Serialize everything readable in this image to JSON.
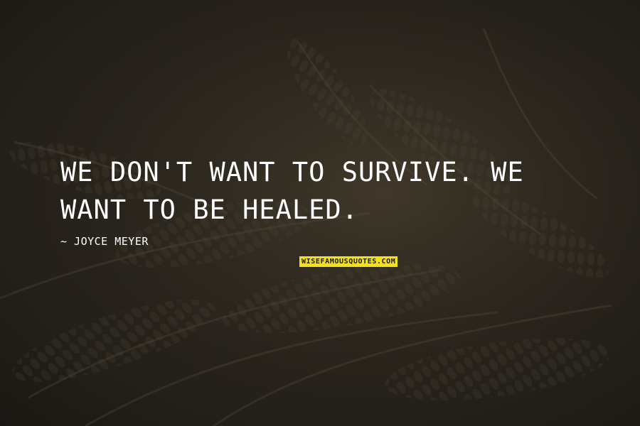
{
  "quote": {
    "text": "We don't want to survive. We want to be healed."
  },
  "author": {
    "text": "~ Joyce Meyer"
  },
  "brand": {
    "text": "WISEFAMOUSQUOTES.COM",
    "background_color": "#f5e11a"
  },
  "colors": {
    "text": "#ffffff",
    "background": "#2a261f"
  }
}
